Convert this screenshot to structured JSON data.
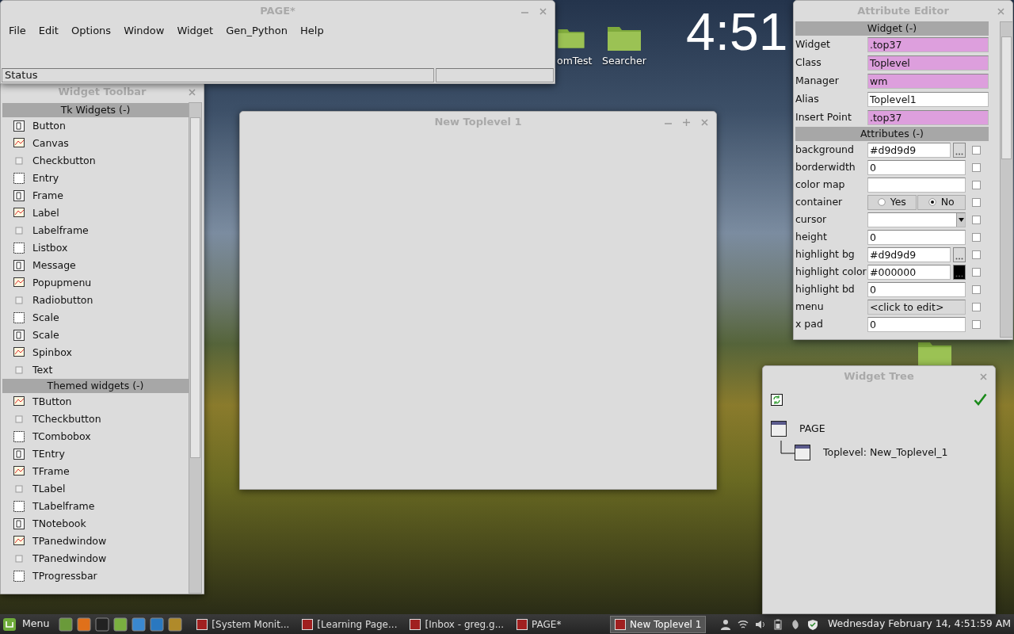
{
  "desktop": {
    "clock": "4:51",
    "icons": [
      {
        "label": "omTest"
      },
      {
        "label": "Searcher"
      }
    ]
  },
  "page_window": {
    "title": "PAGE*",
    "menu": [
      "File",
      "Edit",
      "Options",
      "Window",
      "Widget",
      "Gen_Python",
      "Help"
    ],
    "status": "Status"
  },
  "widget_toolbar": {
    "title": "Widget Toolbar",
    "sections": [
      {
        "title": "Tk Widgets (-)",
        "items": [
          "Button",
          "Canvas",
          "Checkbutton",
          "Entry",
          "Frame",
          "Label",
          "Labelframe",
          "Listbox",
          "Message",
          "Popupmenu",
          "Radiobutton",
          "Scale",
          "Scale",
          "Spinbox",
          "Text"
        ]
      },
      {
        "title": "Themed widgets (-)",
        "items": [
          "TButton",
          "TCheckbutton",
          "TCombobox",
          "TEntry",
          "TFrame",
          "TLabel",
          "TLabelframe",
          "TNotebook",
          "TPanedwindow",
          "TPanedwindow",
          "TProgressbar"
        ]
      }
    ]
  },
  "toplevel_window": {
    "title": "New Toplevel 1"
  },
  "attribute_editor": {
    "title": "Attribute Editor",
    "widget_section": {
      "title": "Widget (-)",
      "rows": [
        {
          "label": "Widget",
          "value": ".top37",
          "readonly": true
        },
        {
          "label": "Class",
          "value": "Toplevel",
          "readonly": true
        },
        {
          "label": "Manager",
          "value": "wm",
          "readonly": true
        },
        {
          "label": "Alias",
          "value": "Toplevel1",
          "readonly": false
        },
        {
          "label": "Insert Point",
          "value": ".top37",
          "readonly": true
        }
      ]
    },
    "attributes_section": {
      "title": "Attributes (-)",
      "rows": [
        {
          "kind": "color",
          "label": "background",
          "value": "#d9d9d9",
          "checked": false
        },
        {
          "kind": "text",
          "label": "borderwidth",
          "value": "0",
          "checked": false
        },
        {
          "kind": "text",
          "label": "color map",
          "checked": false
        },
        {
          "kind": "radio",
          "label": "container",
          "options": [
            {
              "label": "Yes",
              "selected": false
            },
            {
              "label": "No",
              "selected": true
            }
          ],
          "checked": false
        },
        {
          "kind": "combo",
          "label": "cursor",
          "checked": false
        },
        {
          "kind": "text",
          "label": "height",
          "value": "0",
          "checked": false
        },
        {
          "kind": "color",
          "label": "highlight bg",
          "value": "#d9d9d9",
          "checked": false
        },
        {
          "kind": "color",
          "label": "highlight color",
          "value": "#000000",
          "checked": false
        },
        {
          "kind": "text",
          "label": "highlight bd",
          "value": "0",
          "checked": false
        },
        {
          "kind": "button",
          "label": "menu",
          "value": "<click to edit>",
          "checked": false
        },
        {
          "kind": "text",
          "label": "x pad",
          "value": "0",
          "checked": false
        }
      ]
    }
  },
  "widget_tree": {
    "title": "Widget Tree",
    "tree": [
      {
        "label": "PAGE",
        "children": [
          {
            "label": "Toplevel: New_Toplevel_1"
          }
        ]
      }
    ]
  },
  "taskbar": {
    "menu": "Menu",
    "tasks": [
      {
        "label": "[System Monit...",
        "selected": false
      },
      {
        "label": "[Learning Page...",
        "selected": false
      },
      {
        "label": "[Inbox - greg.g...",
        "selected": false
      },
      {
        "label": "PAGE*",
        "selected": false
      },
      {
        "label": "New Toplevel 1",
        "selected": true
      }
    ],
    "datetime": "Wednesday February 14,  4:51:59 AM"
  }
}
